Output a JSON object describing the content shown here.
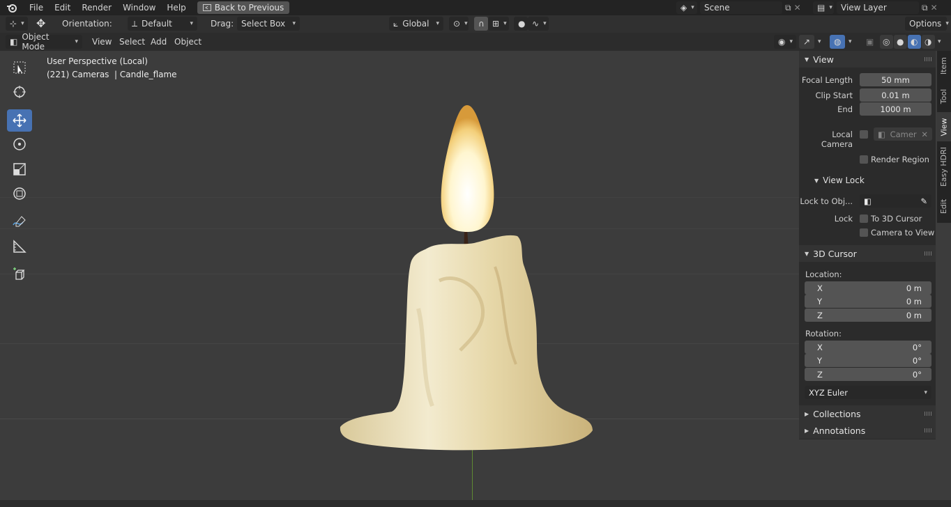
{
  "menubar": {
    "items": [
      "File",
      "Edit",
      "Render",
      "Window",
      "Help"
    ],
    "back_label": "Back to Previous",
    "scene": "Scene",
    "view_layer": "View Layer"
  },
  "tool_header": {
    "orientation_label": "Orientation:",
    "orientation_value": "Default",
    "drag_label": "Drag:",
    "drag_value": "Select Box",
    "transform_orientation": "Global",
    "options_label": "Options"
  },
  "view_header": {
    "mode": "Object Mode",
    "menus": [
      "View",
      "Select",
      "Add",
      "Object"
    ]
  },
  "viewport": {
    "perspective_text": "User Perspective (Local)",
    "object_text": "(221) Cameras  | Candle_flame"
  },
  "sidebar": {
    "tabs": [
      "Item",
      "Tool",
      "View",
      "Easy HDRI",
      "Edit"
    ],
    "view_panel": {
      "title": "View",
      "focal_length_label": "Focal Length",
      "focal_length": "50 mm",
      "clip_start_label": "Clip Start",
      "clip_start": "0.01 m",
      "clip_end_label": "End",
      "clip_end": "1000 m",
      "local_camera_label": "Local Camera",
      "local_camera_value": "Camer",
      "render_region_label": "Render Region"
    },
    "view_lock": {
      "title": "View Lock",
      "lock_to_obj_label": "Lock to Obj...",
      "lock_label": "Lock",
      "to_3d_cursor_label": "To 3D Cursor",
      "camera_to_view_label": "Camera to View"
    },
    "cursor_panel": {
      "title": "3D Cursor",
      "location_label": "Location:",
      "loc_x": "0 m",
      "loc_y": "0 m",
      "loc_z": "0 m",
      "rotation_label": "Rotation:",
      "rot_x": "0°",
      "rot_y": "0°",
      "rot_z": "0°",
      "rotation_mode": "XYZ Euler"
    },
    "collections_title": "Collections",
    "annotations_title": "Annotations"
  },
  "axis_labels": {
    "x": "X",
    "y": "Y",
    "z": "Z"
  },
  "colors": {
    "accent": "#4772b3",
    "background": "#3c3c3c",
    "panel": "#2b2b2b"
  }
}
